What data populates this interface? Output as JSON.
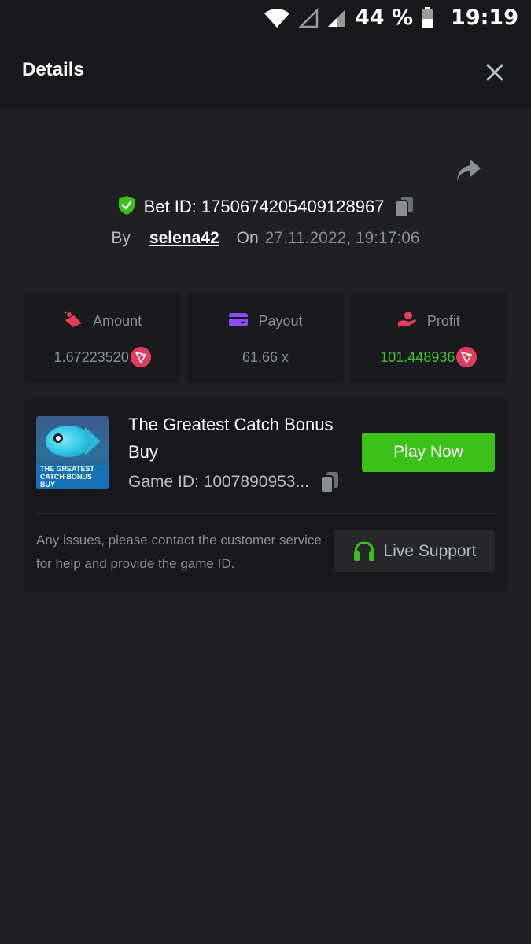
{
  "status_bar": {
    "battery_percent": "44 %",
    "time": "19:19",
    "icons": [
      "wifi-icon",
      "signal-empty-icon",
      "signal-icon",
      "battery-icon"
    ]
  },
  "header": {
    "title": "Details",
    "close_icon": "close-icon"
  },
  "bet": {
    "bet_id_text": "Bet ID: 1750674205409128967",
    "by_label": "By",
    "username": "selena42",
    "on_label": "On",
    "datetime": "27.11.2022, 19:17:06"
  },
  "stats": [
    {
      "label": "Amount",
      "value": "1.67223520",
      "icon": "amount-icon",
      "coin": "tron-icon"
    },
    {
      "label": "Payout",
      "value": "61.66 x",
      "icon": "wallet-icon"
    },
    {
      "label": "Profit",
      "value": "101.448936",
      "icon": "profit-hand-icon",
      "coin": "tron-icon"
    }
  ],
  "game": {
    "name": "The Greatest Catch Bonus Buy",
    "thumb_title": "THE GREATEST CATCH BONUS BUY",
    "game_id_text": "Game ID: 1007890953...",
    "play_label": "Play Now",
    "help_text": "Any issues, please contact the customer service for help and provide the game ID.",
    "support_label": "Live Support"
  },
  "colors": {
    "background": "#1e2024",
    "panel": "#17181b",
    "accent_green": "#3bc117",
    "profit_green": "#3fc52a",
    "tron_red": "#e23b5d",
    "muted_text": "#8b8e96"
  }
}
